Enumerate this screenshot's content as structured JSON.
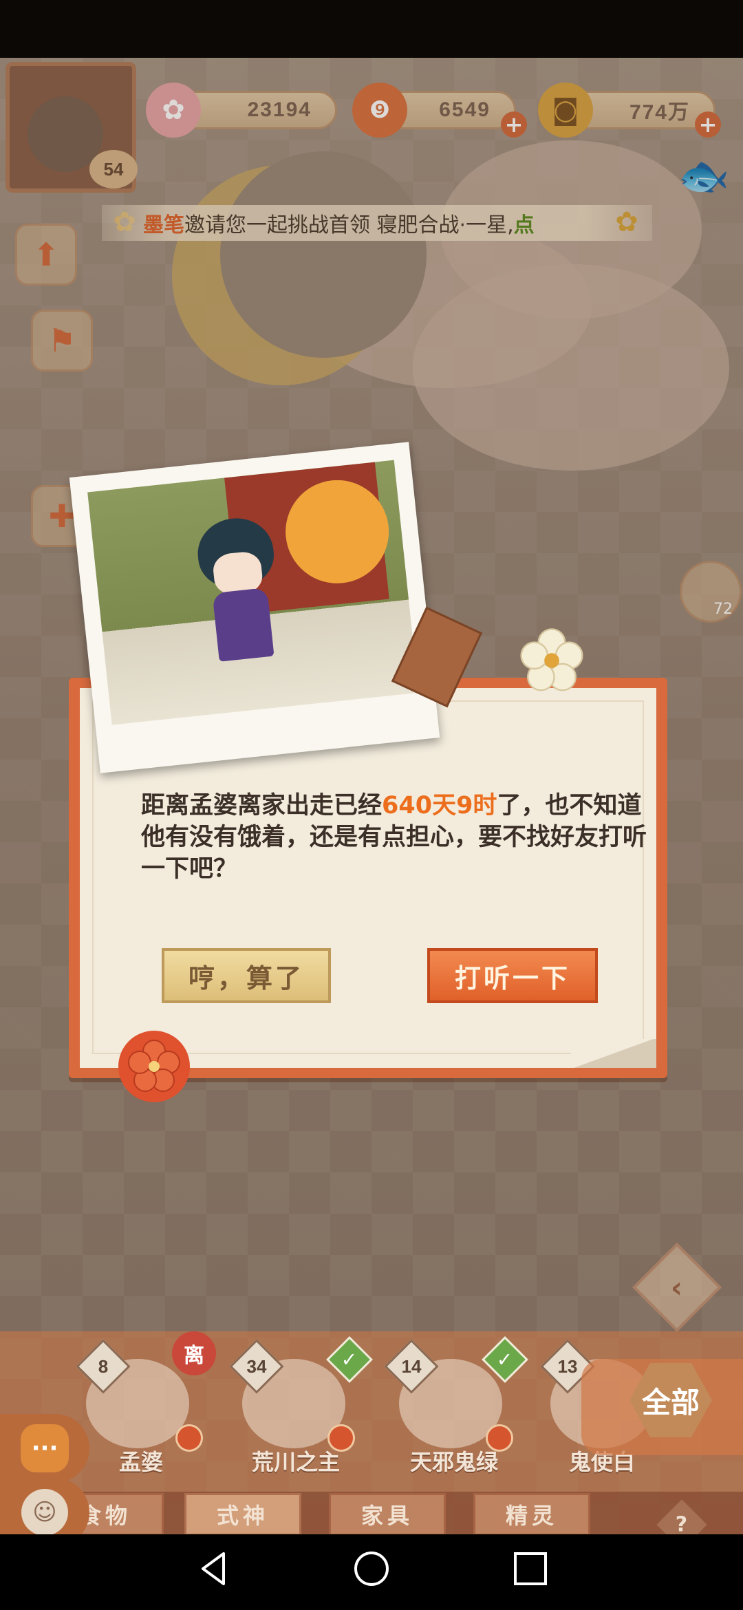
{
  "top_bar": {
    "player_level": "54",
    "resources": [
      {
        "icon": "sakura-icon",
        "value": "23194"
      },
      {
        "icon": "magatama-icon",
        "value": "6549"
      },
      {
        "icon": "coin-icon",
        "value": "774万"
      }
    ]
  },
  "marquee": {
    "name": "墨笔",
    "text": "邀请您一起挑战首领 寝肥合战·一星,",
    "action": "点"
  },
  "side_badges": {
    "event_count": "72"
  },
  "dialog": {
    "text_before": "距离孟婆离家出走已经",
    "highlight": "640天9时",
    "text_after": "了，也不知道他有没有饿着，还是有点担心，要不找好友打听一下吧？",
    "cancel_label": "哼，算了",
    "ask_label": "打听一下"
  },
  "roster": {
    "away_badge": "离",
    "items": [
      {
        "name": "孟婆",
        "level": "8"
      },
      {
        "name": "荒川之主",
        "level": "34"
      },
      {
        "name": "天邪鬼绿",
        "level": "14"
      },
      {
        "name": "鬼使白",
        "level": "13"
      }
    ],
    "all_label": "全部"
  },
  "tabs": [
    "食物",
    "式神",
    "家具",
    "精灵"
  ],
  "help_label": "?",
  "colors": {
    "accent_orange": "#e0612a",
    "highlight_text": "#ec6e1d",
    "marquee_name": "#e0632b",
    "marquee_action": "#5b8a1e"
  }
}
